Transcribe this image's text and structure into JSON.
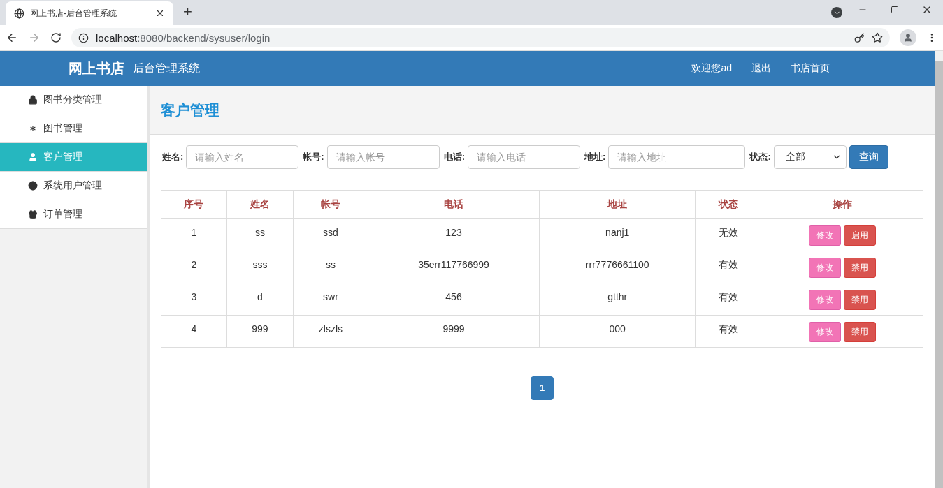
{
  "browser": {
    "tab_title": "网上书店-后台管理系统",
    "new_tab": "+",
    "url_host": "localhost",
    "url_path": ":8080/backend/sysuser/login"
  },
  "header": {
    "brand": "网上书店",
    "subtitle": "后台管理系统",
    "nav": [
      "欢迎您ad",
      "退出",
      "书店首页"
    ]
  },
  "sidebar": {
    "items": [
      {
        "label": "图书分类管理",
        "selected": false
      },
      {
        "label": "图书管理",
        "selected": false
      },
      {
        "label": "客户管理",
        "selected": true
      },
      {
        "label": "系统用户管理",
        "selected": false
      },
      {
        "label": "订单管理",
        "selected": false
      }
    ]
  },
  "page_title": "客户管理",
  "filters": [
    {
      "label": "姓名:",
      "placeholder": "请输入姓名"
    },
    {
      "label": "帐号:",
      "placeholder": "请输入帐号"
    },
    {
      "label": "电话:",
      "placeholder": "请输入电话"
    },
    {
      "label": "地址:",
      "placeholder": "请输入地址"
    }
  ],
  "status_filter": {
    "label": "状态:",
    "value": "全部"
  },
  "search_button": "查询",
  "table": {
    "columns": [
      "序号",
      "姓名",
      "帐号",
      "电话",
      "地址",
      "状态",
      "操作"
    ],
    "rows": [
      {
        "cells": [
          "1",
          "ss",
          "ssd",
          "123",
          "nanj1",
          "无效"
        ],
        "actions": [
          {
            "kind": "edit",
            "label": "修改"
          },
          {
            "kind": "toggle",
            "label": "启用"
          }
        ]
      },
      {
        "cells": [
          "2",
          "sss",
          "ss",
          "35err117766999",
          "rrr7776661100",
          "有效"
        ],
        "actions": [
          {
            "kind": "edit",
            "label": "修改"
          },
          {
            "kind": "toggle",
            "label": "禁用"
          }
        ]
      },
      {
        "cells": [
          "3",
          "d",
          "swr",
          "456",
          "gtthr",
          "有效"
        ],
        "actions": [
          {
            "kind": "edit",
            "label": "修改"
          },
          {
            "kind": "toggle",
            "label": "禁用"
          }
        ]
      },
      {
        "cells": [
          "4",
          "999",
          "zlszls",
          "9999",
          "000",
          "有效"
        ],
        "actions": [
          {
            "kind": "edit",
            "label": "修改"
          },
          {
            "kind": "toggle",
            "label": "禁用"
          }
        ]
      }
    ]
  },
  "pagination": [
    {
      "label": "1",
      "selected": true
    }
  ]
}
